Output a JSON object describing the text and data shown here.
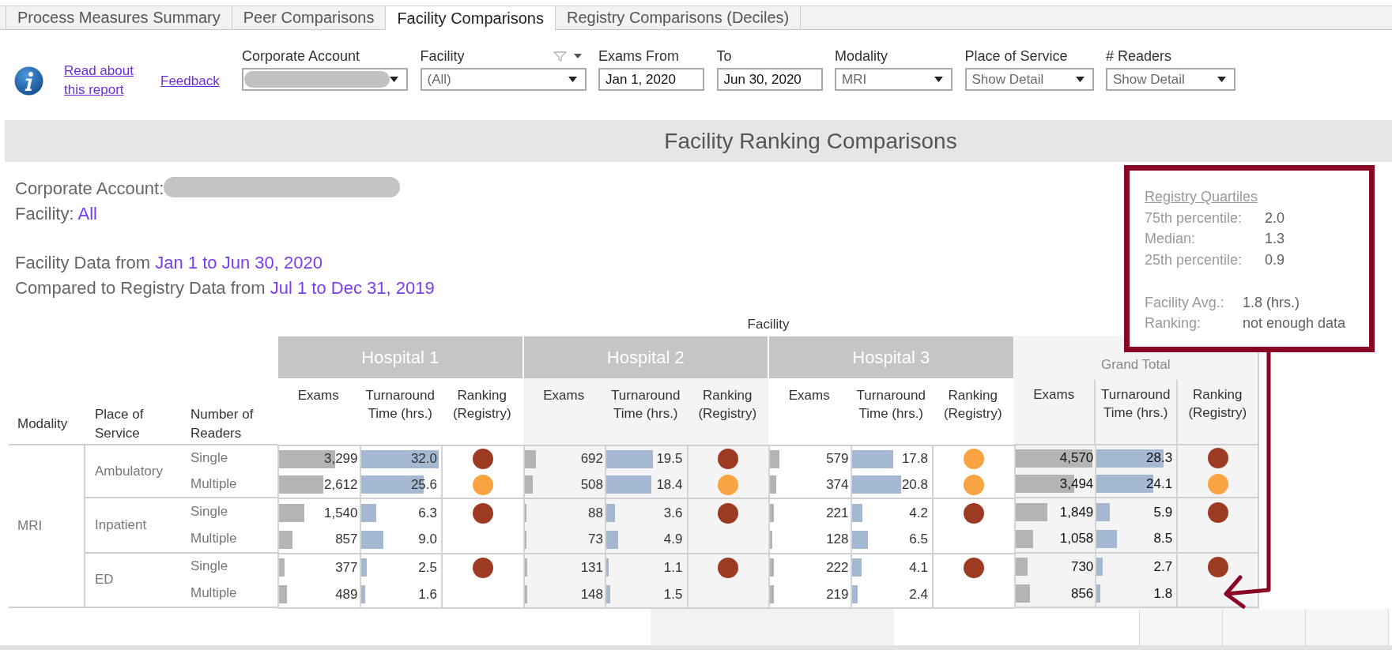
{
  "tabs": [
    {
      "label": "Process Measures Summary",
      "selected": false
    },
    {
      "label": "Peer Comparisons",
      "selected": false
    },
    {
      "label": "Facility Comparisons",
      "selected": true
    },
    {
      "label": "Registry Comparisons (Deciles)",
      "selected": false
    }
  ],
  "report_link": "Read about this report",
  "feedback_link": "Feedback",
  "filters": [
    {
      "label": "Corporate Account",
      "kind": "dropdown",
      "redacted": true,
      "filter_menu": false
    },
    {
      "label": "Facility",
      "kind": "dropdown",
      "value": "(All)",
      "redacted": false,
      "filter_menu": true
    },
    {
      "label": "Exams From",
      "kind": "date",
      "value": "Jan 1, 2020",
      "redacted": false,
      "filter_menu": false
    },
    {
      "label": "To",
      "kind": "date",
      "value": "Jun 30, 2020",
      "redacted": false,
      "filter_menu": false
    },
    {
      "label": "Modality",
      "kind": "dropdown",
      "value": "MRI",
      "redacted": false,
      "filter_menu": false
    },
    {
      "label": "Place of Service",
      "kind": "dropdown",
      "value": "Show Detail",
      "redacted": false,
      "filter_menu": false
    },
    {
      "label": "# Readers",
      "kind": "dropdown",
      "value": "Show Detail",
      "redacted": false,
      "filter_menu": false
    }
  ],
  "banner": {
    "title": "Facility Ranking Comparisons"
  },
  "summary": {
    "scope": [
      {
        "label": "Corporate Account:",
        "redacted": true
      },
      {
        "label": "Facility:",
        "value": "All",
        "redacted": false
      }
    ],
    "period": [
      {
        "label": "Facility Data from",
        "value": "Jan 1 to Jun 30, 2020",
        "redacted": false
      },
      {
        "label": "Compared to Registry Data from",
        "value": "Jul 1 to Dec 31, 2019",
        "redacted": false
      }
    ]
  },
  "quartiles": {
    "title": "Registry Quartiles",
    "percentiles": [
      {
        "label": "75th percentile:",
        "value": "2.0"
      },
      {
        "label": "Median:",
        "value": "1.3"
      },
      {
        "label": "25th percentile:",
        "value": "0.9"
      }
    ],
    "facility": [
      {
        "label": "Facility Avg.:",
        "value": "1.8 (hrs.)"
      },
      {
        "label": "Ranking:",
        "value": "not enough data"
      }
    ]
  },
  "table": {
    "dimension_label": "Facility",
    "row_headers": [
      "Modality",
      "Place of Service",
      "Number of Readers"
    ],
    "modality": "MRI",
    "places": [
      {
        "name": "Ambulatory",
        "readers": [
          "Single",
          "Multiple"
        ]
      },
      {
        "name": "Inpatient",
        "readers": [
          "Single",
          "Multiple"
        ]
      },
      {
        "name": "ED",
        "readers": [
          "Single",
          "Multiple"
        ]
      }
    ],
    "column_groups": [
      {
        "kind": "facility",
        "name": "Hospital 1",
        "headers": [
          "Exams",
          "Turnaround Time (hrs.)",
          "Ranking (Registry)"
        ],
        "rows": [
          {
            "exams": {
              "value": "3,299",
              "level": 0.7
            },
            "turnaround": {
              "value": "32.0",
              "level": 0.97
            },
            "ranking": {
              "color": "#9c3a22"
            }
          },
          {
            "exams": {
              "value": "2,612",
              "level": 0.55
            },
            "turnaround": {
              "value": "25.6",
              "level": 0.78
            },
            "ranking": {
              "color": "#f9a343"
            }
          },
          {
            "exams": {
              "value": "1,540",
              "level": 0.32
            },
            "turnaround": {
              "value": "6.3",
              "level": 0.19
            },
            "ranking": {
              "color": "#9c3a22"
            }
          },
          {
            "exams": {
              "value": "857",
              "level": 0.17
            },
            "turnaround": {
              "value": "9.0",
              "level": 0.28
            }
          },
          {
            "exams": {
              "value": "377",
              "level": 0.07
            },
            "turnaround": {
              "value": "2.5",
              "level": 0.07
            },
            "ranking": {
              "color": "#9c3a22"
            }
          },
          {
            "exams": {
              "value": "489",
              "level": 0.1
            },
            "turnaround": {
              "value": "1.6",
              "level": 0.05
            }
          }
        ]
      },
      {
        "kind": "facility",
        "name": "Hospital 2",
        "headers": [
          "Exams",
          "Turnaround Time (hrs.)",
          "Ranking (Registry)"
        ],
        "rows": [
          {
            "exams": {
              "value": "692",
              "level": 0.14
            },
            "turnaround": {
              "value": "19.5",
              "level": 0.58
            },
            "ranking": {
              "color": "#9c3a22"
            }
          },
          {
            "exams": {
              "value": "508",
              "level": 0.1
            },
            "turnaround": {
              "value": "18.4",
              "level": 0.56
            },
            "ranking": {
              "color": "#f9a343"
            }
          },
          {
            "exams": {
              "value": "88",
              "level": 0.02
            },
            "turnaround": {
              "value": "3.6",
              "level": 0.11
            },
            "ranking": {
              "color": "#9c3a22"
            }
          },
          {
            "exams": {
              "value": "73",
              "level": 0.02
            },
            "turnaround": {
              "value": "4.9",
              "level": 0.15
            }
          },
          {
            "exams": {
              "value": "131",
              "level": 0.03
            },
            "turnaround": {
              "value": "1.1",
              "level": 0.03
            },
            "ranking": {
              "color": "#9c3a22"
            }
          },
          {
            "exams": {
              "value": "148",
              "level": 0.03
            },
            "turnaround": {
              "value": "1.5",
              "level": 0.05
            }
          }
        ]
      },
      {
        "kind": "facility",
        "name": "Hospital 3",
        "headers": [
          "Exams",
          "Turnaround Time (hrs.)",
          "Ranking (Registry)"
        ],
        "rows": [
          {
            "exams": {
              "value": "579",
              "level": 0.12
            },
            "turnaround": {
              "value": "17.8",
              "level": 0.52
            },
            "ranking": {
              "color": "#f9a343"
            }
          },
          {
            "exams": {
              "value": "374",
              "level": 0.08
            },
            "turnaround": {
              "value": "20.8",
              "level": 0.62
            },
            "ranking": {
              "color": "#f9a343"
            }
          },
          {
            "exams": {
              "value": "221",
              "level": 0.05
            },
            "turnaround": {
              "value": "4.2",
              "level": 0.13
            },
            "ranking": {
              "color": "#9c3a22"
            }
          },
          {
            "exams": {
              "value": "128",
              "level": 0.03
            },
            "turnaround": {
              "value": "6.5",
              "level": 0.2
            }
          },
          {
            "exams": {
              "value": "222",
              "level": 0.05
            },
            "turnaround": {
              "value": "4.1",
              "level": 0.12
            },
            "ranking": {
              "color": "#9c3a22"
            }
          },
          {
            "exams": {
              "value": "219",
              "level": 0.05
            },
            "turnaround": {
              "value": "2.4",
              "level": 0.07
            }
          }
        ]
      },
      {
        "kind": "total",
        "name": "Grand Total",
        "headers": [
          "Exams",
          "Turnaround Time (hrs.)",
          "Ranking (Registry)"
        ],
        "rows": [
          {
            "exams": {
              "value": "4,570",
              "level": 0.97
            },
            "turnaround": {
              "value": "28.3",
              "level": 0.84
            },
            "ranking": {
              "color": "#9c3a22"
            }
          },
          {
            "exams": {
              "value": "3,494",
              "level": 0.74
            },
            "turnaround": {
              "value": "24.1",
              "level": 0.71
            },
            "ranking": {
              "color": "#f9a343"
            }
          },
          {
            "exams": {
              "value": "1,849",
              "level": 0.4
            },
            "turnaround": {
              "value": "5.9",
              "level": 0.17
            },
            "ranking": {
              "color": "#9c3a22"
            }
          },
          {
            "exams": {
              "value": "1,058",
              "level": 0.22
            },
            "turnaround": {
              "value": "8.5",
              "level": 0.25
            }
          },
          {
            "exams": {
              "value": "730",
              "level": 0.15
            },
            "turnaround": {
              "value": "2.7",
              "level": 0.08
            },
            "ranking": {
              "color": "#9c3a22"
            }
          },
          {
            "exams": {
              "value": "856",
              "level": 0.18
            },
            "turnaround": {
              "value": "1.8",
              "level": 0.05
            }
          }
        ]
      }
    ]
  }
}
